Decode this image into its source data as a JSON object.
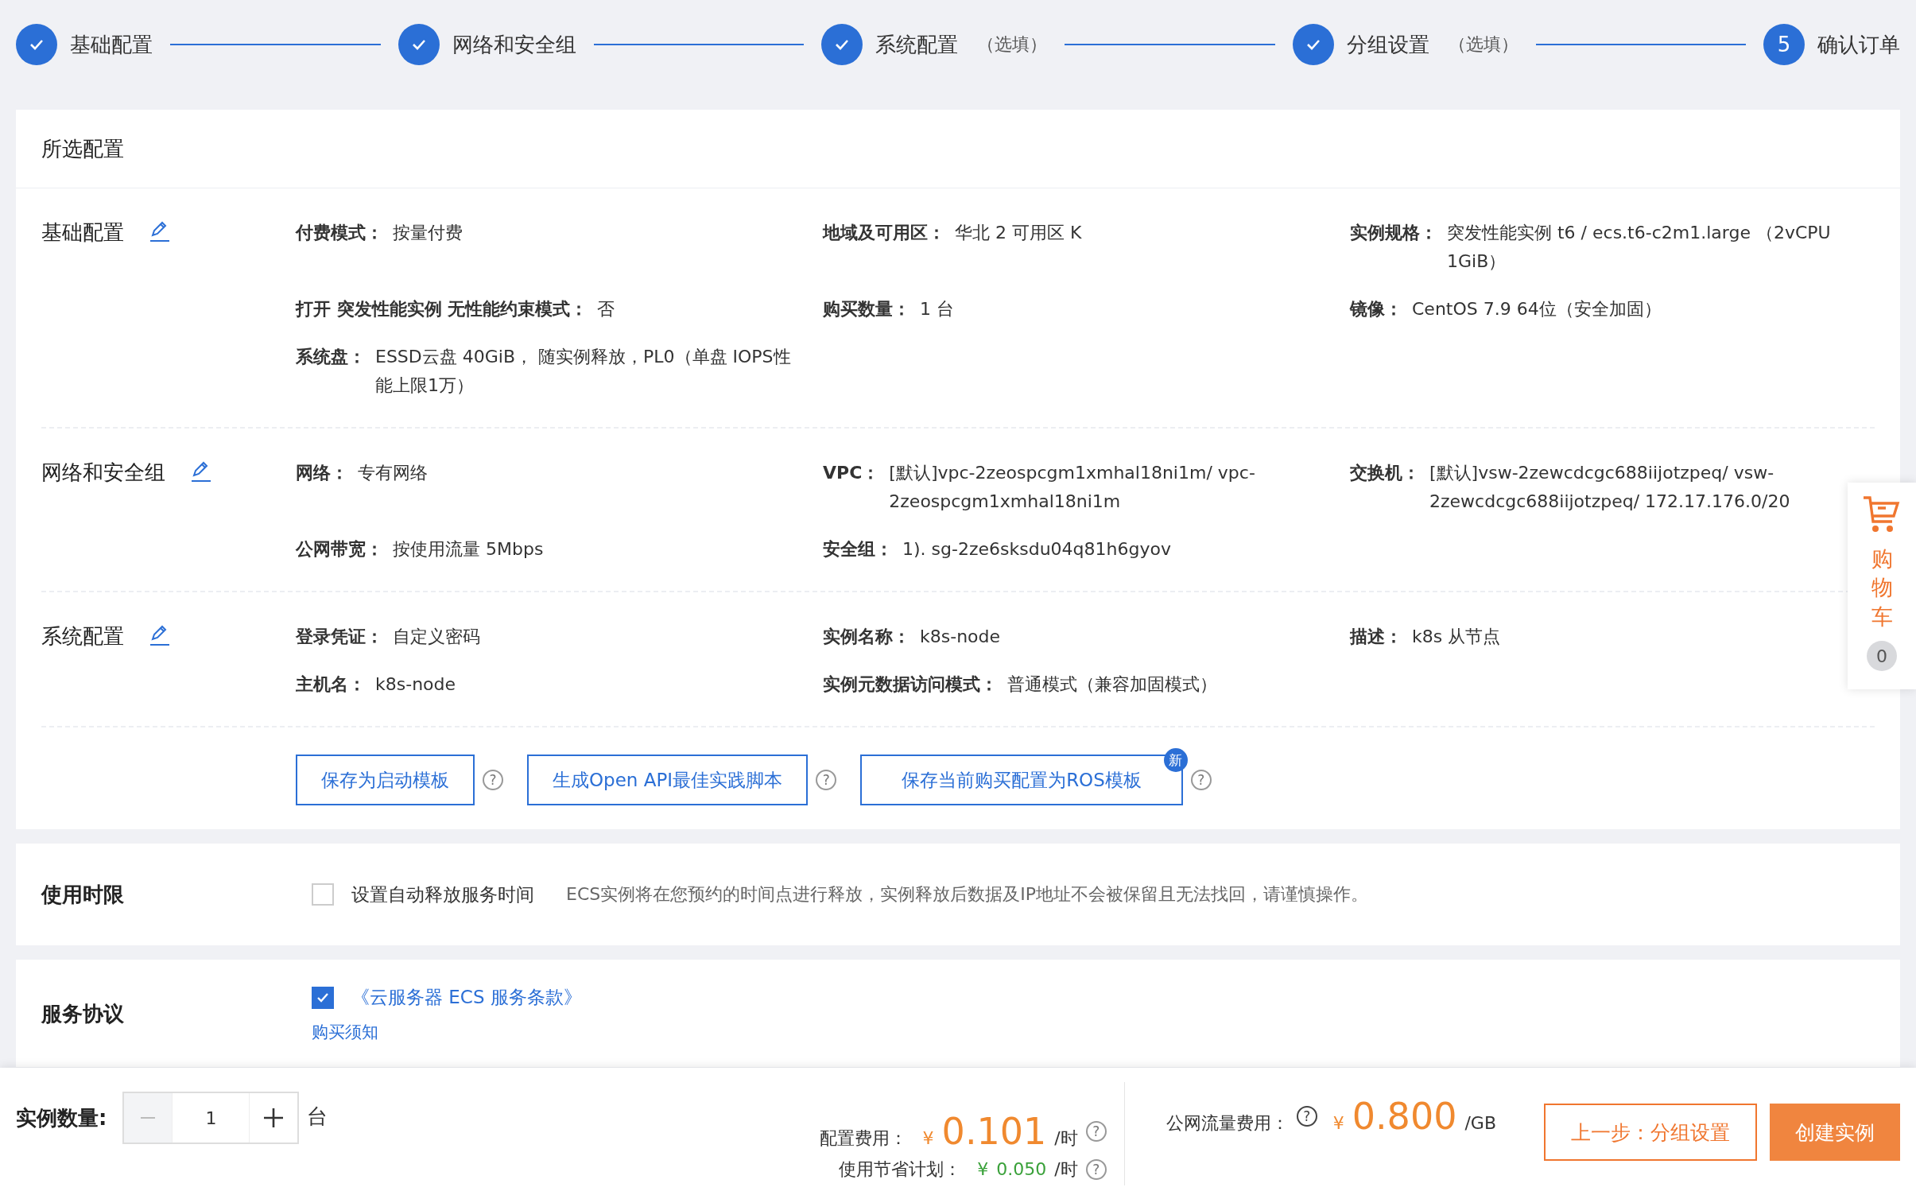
{
  "steps": [
    {
      "label": "基础配置",
      "done": true
    },
    {
      "label": "网络和安全组",
      "done": true
    },
    {
      "label": "系统配置",
      "note": "（选填）",
      "done": true
    },
    {
      "label": "分组设置",
      "note": "（选填）",
      "done": true
    },
    {
      "label": "确认订单",
      "number": "5",
      "done": false
    }
  ],
  "summary": {
    "title": "所选配置",
    "sections": [
      {
        "title": "基础配置",
        "items": [
          {
            "label": "付费模式：",
            "value": "按量付费"
          },
          {
            "label": "地域及可用区：",
            "value": "华北 2 可用区 K"
          },
          {
            "label": "实例规格：",
            "value": "突发性能实例 t6 / ecs.t6-c2m1.large （2vCPU 1GiB）"
          },
          {
            "label": "打开 突发性能实例 无性能约束模式：",
            "value": "否"
          },
          {
            "label": "购买数量：",
            "value": "1 台"
          },
          {
            "label": "镜像：",
            "value": "CentOS 7.9 64位（安全加固）"
          },
          {
            "label": "系统盘：",
            "value": "ESSD云盘 40GiB， 随实例释放，PL0（单盘 IOPS性能上限1万）"
          }
        ]
      },
      {
        "title": "网络和安全组",
        "items": [
          {
            "label": "网络：",
            "value": "专有网络"
          },
          {
            "label": "VPC：",
            "value": "[默认]vpc-2zeospcgm1xmhal18ni1m/ vpc-2zeospcgm1xmhal18ni1m"
          },
          {
            "label": "交换机：",
            "value": "[默认]vsw-2zewcdcgc688iijotzpeq/ vsw-2zewcdcgc688iijotzpeq/ 172.17.176.0/20"
          },
          {
            "label": "公网带宽：",
            "value": "按使用流量 5Mbps"
          },
          {
            "label": "安全组：",
            "value": "1). sg-2ze6sksdu04q81h6gyov"
          }
        ]
      },
      {
        "title": "系统配置",
        "items": [
          {
            "label": "登录凭证：",
            "value": "自定义密码"
          },
          {
            "label": "实例名称：",
            "value": "k8s-node"
          },
          {
            "label": "描述：",
            "value": "k8s 从节点"
          },
          {
            "label": "主机名：",
            "value": "k8s-node"
          },
          {
            "label": "实例元数据访问模式：",
            "value": "普通模式（兼容加固模式）"
          }
        ]
      }
    ],
    "buttons": [
      {
        "label": "保存为启动模板",
        "help": "?"
      },
      {
        "label": "生成Open API最佳实践脚本",
        "help": "?"
      },
      {
        "label": "保存当前购买配置为ROS模板",
        "badge": "新",
        "help": "?"
      }
    ]
  },
  "duration": {
    "title": "使用时限",
    "checkbox": {
      "label": "设置自动释放服务时间",
      "checked": false
    },
    "note": "ECS实例将在您预约的时间点进行释放，实例释放后数据及IP地址不会被保留且无法找回，请谨慎操作。"
  },
  "agreement": {
    "title": "服务协议",
    "checkbox": {
      "label": "《云服务器 ECS 服务条款》",
      "checked": true
    },
    "link": "购买须知"
  },
  "cart": {
    "label": "购物车",
    "count": "0"
  },
  "footer": {
    "quantity_label": "实例数量:",
    "quantity": "1",
    "minus_disabled": true,
    "unit": "台",
    "config_fee": {
      "label": "配置费用：",
      "currency": "¥",
      "amount": "0.101",
      "unit": "/时",
      "help": "?"
    },
    "savings": {
      "label": "使用节省计划：",
      "currency": "¥",
      "amount": "0.050",
      "unit": "/时",
      "help": "?"
    },
    "traffic_fee": {
      "label": "公网流量费用：",
      "currency": "¥",
      "amount": "0.800",
      "unit": "/GB",
      "help": "?"
    },
    "buttons": [
      {
        "label": "上一步：分组设置",
        "kind": "secondary"
      },
      {
        "label": "创建实例",
        "kind": "primary"
      }
    ]
  }
}
